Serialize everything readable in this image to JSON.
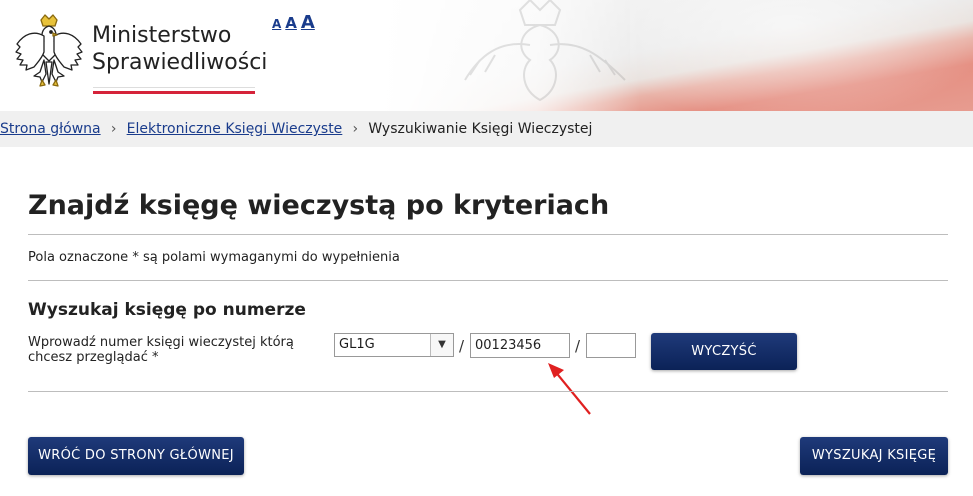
{
  "header": {
    "brand_line1": "Ministerstwo",
    "brand_line2": "Sprawiedliwości",
    "font_controls": [
      "A",
      "A",
      "A"
    ],
    "logo_icon": "polish-eagle-emblem",
    "accent_color": "#d5233a"
  },
  "breadcrumb": {
    "home": "Strona główna",
    "ekw": "Elektroniczne Księgi Wieczyste",
    "current": "Wyszukiwanie Księgi Wieczystej"
  },
  "main": {
    "title": "Znajdź księgę wieczystą po kryteriach",
    "required_note": "Pola oznaczone * są polami wymaganymi do wypełnienia",
    "section_title": "Wyszukaj księgę po numerze",
    "field_label": "Wprowadź numer księgi wieczystej którą chcesz przeglądać *",
    "court_code": "GL1G",
    "slash": "/",
    "book_number": "00123456",
    "control_digit": "",
    "clear_button": "WYCZYŚĆ",
    "back_button": "WRÓĆ DO STRONY GŁÓWNEJ",
    "search_button": "WYSZUKAJ KSIĘGĘ"
  },
  "colors": {
    "button": "#0b2257",
    "link": "#1a3c8c",
    "arrow": "#e02020"
  }
}
